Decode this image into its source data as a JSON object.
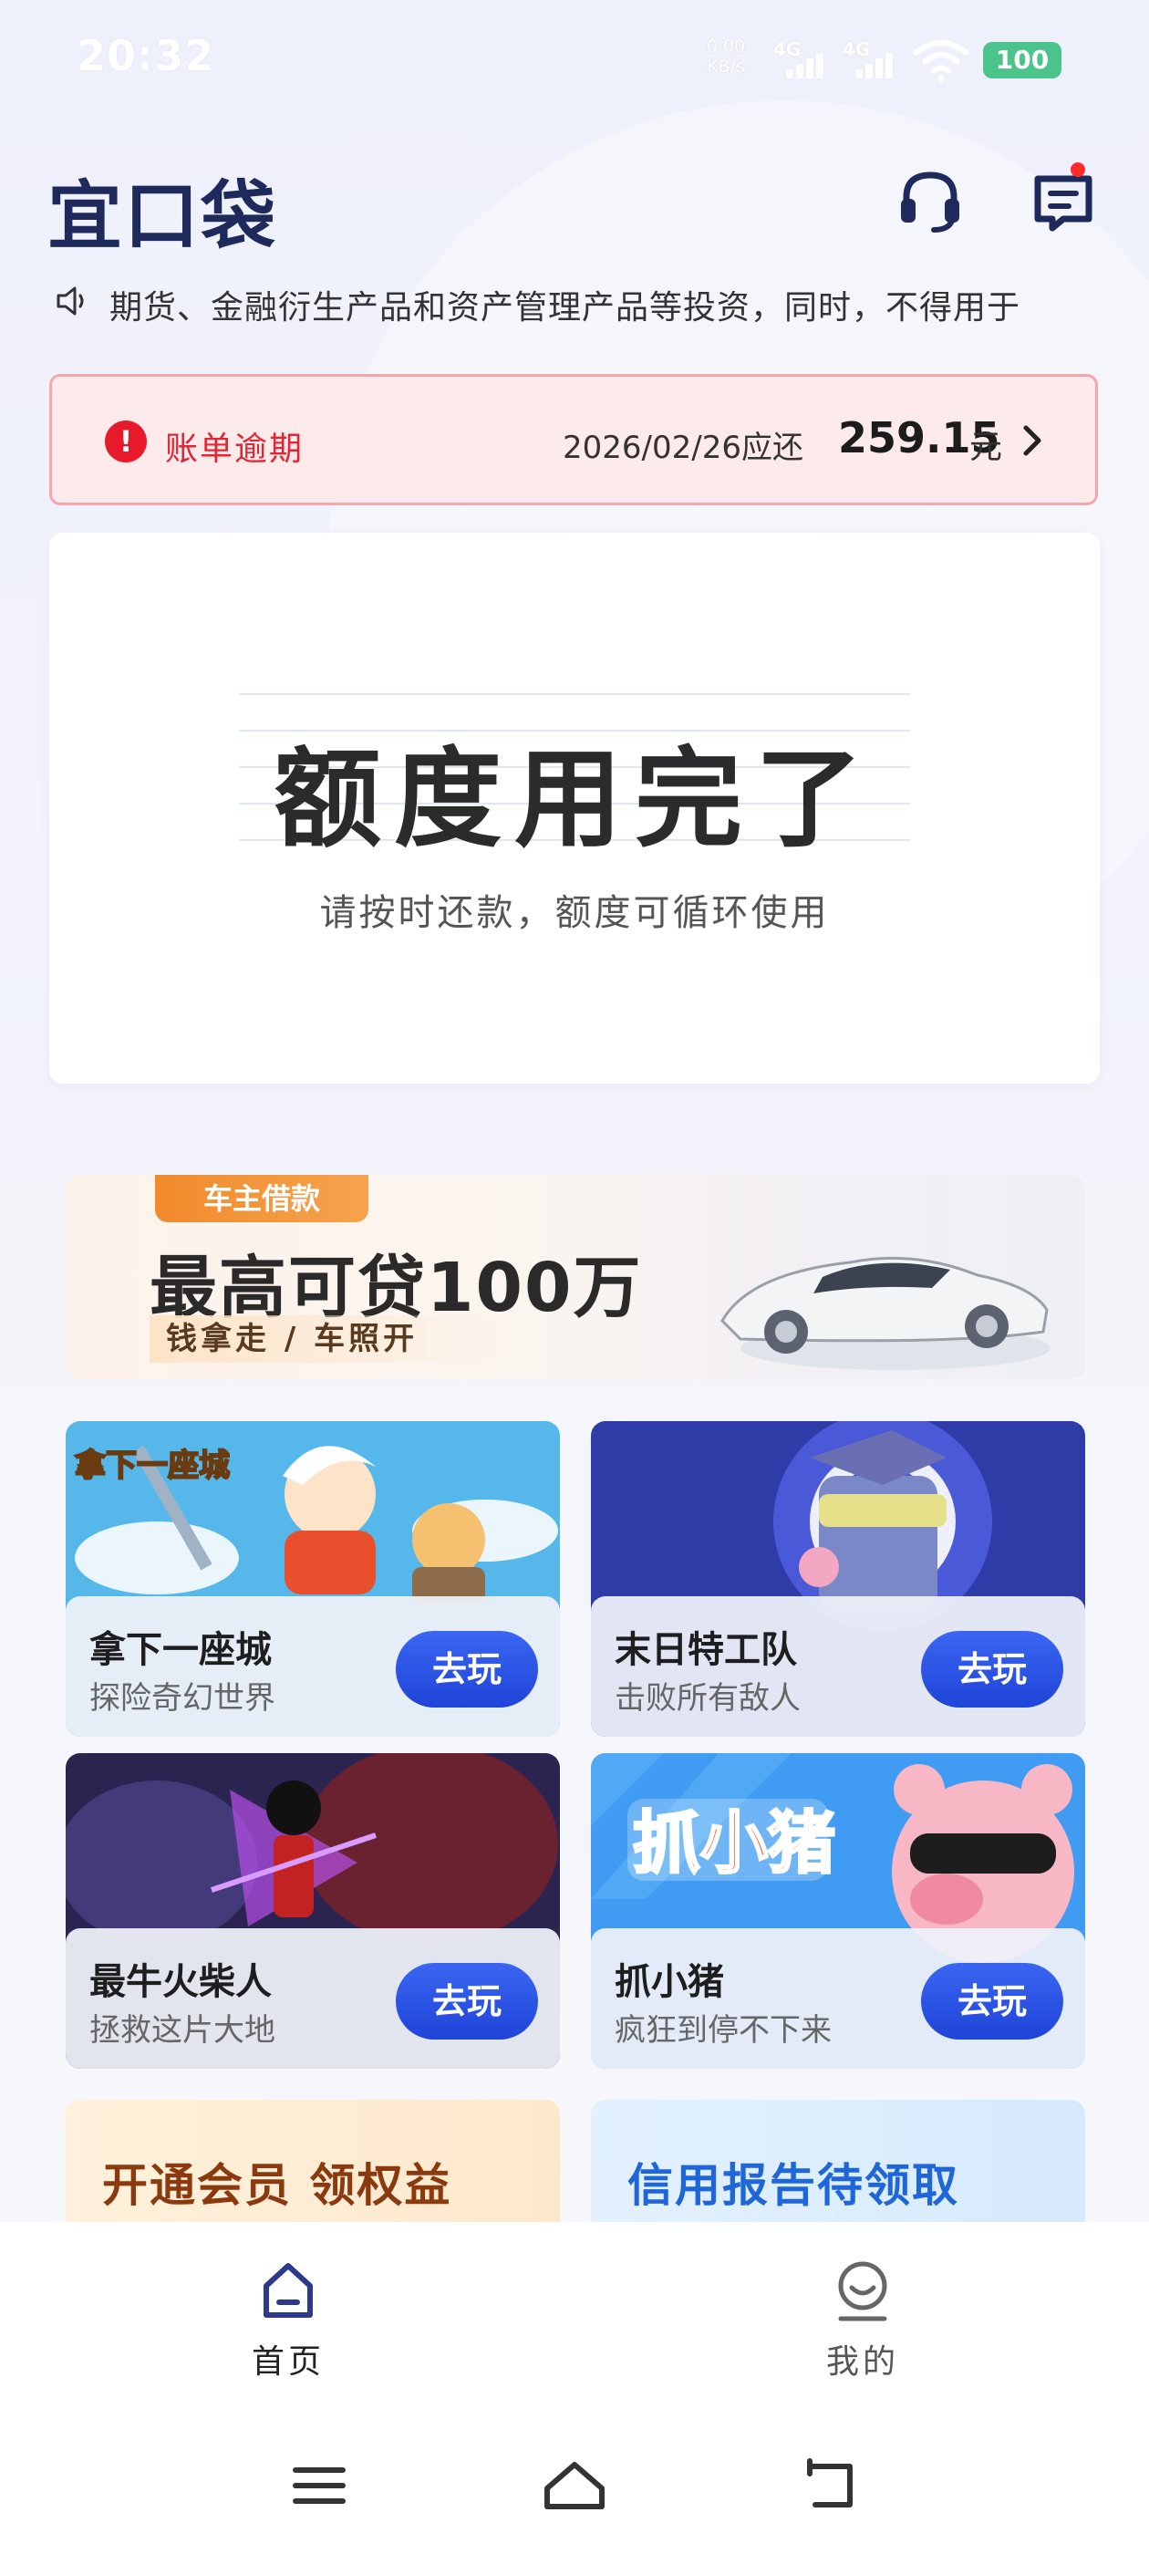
{
  "status_bar": {
    "time": "20:32",
    "net_speed_value": "0.00",
    "net_speed_unit": "KB/s",
    "signal_1_label": "4G",
    "signal_2_label": "4G",
    "battery": "100"
  },
  "header": {
    "logo": "宜口袋",
    "service_icon": "headset-icon",
    "message_icon": "message-icon"
  },
  "notice": {
    "icon": "speaker-icon",
    "text": "期货、金融衍生产品和资产管理产品等投资，同时，不得用于"
  },
  "bill_alert": {
    "label": "账单逾期",
    "due_text": "2026/02/26应还",
    "amount": "259.15",
    "unit": "元"
  },
  "credit": {
    "title": "额度用完了",
    "subtitle": "请按时还款，额度可循环使用"
  },
  "promo": {
    "tag": "车主借款",
    "headline": "最高可贷100万",
    "subline": "钱拿走 / 车照开"
  },
  "games": [
    {
      "name": "拿下一座城",
      "desc": "探险奇幻世界",
      "button": "去玩",
      "art_text": "拿下一座城"
    },
    {
      "name": "末日特工队",
      "desc": "击败所有敌人",
      "button": "去玩"
    },
    {
      "name": "最牛火柴人",
      "desc": "拯救这片大地",
      "button": "去玩"
    },
    {
      "name": "抓小猪",
      "desc": "疯狂到停不下来",
      "button": "去玩",
      "art_text": "抓小猪"
    }
  ],
  "features": [
    {
      "label": "开通会员 领权益"
    },
    {
      "label": "信用报告待领取"
    }
  ],
  "tabs": [
    {
      "label": "首页",
      "active": true
    },
    {
      "label": "我的",
      "active": false
    }
  ],
  "colors": {
    "brand": "#1f2a5c",
    "accent_blue": "#2b55e6",
    "alert_red": "#e02534",
    "tab_active": "#2d3a8c",
    "tab_inactive": "#666666"
  }
}
